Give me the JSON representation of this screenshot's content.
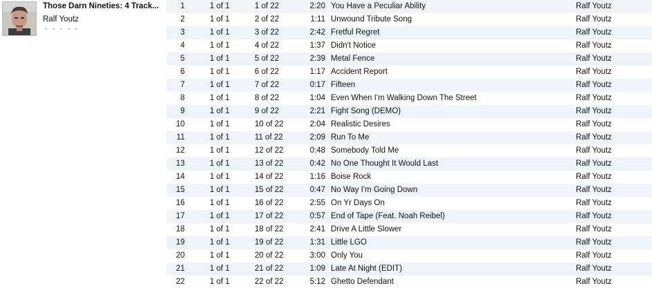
{
  "album": {
    "title": "Those Darn Nineties: 4 Track...",
    "artist": "Ralf Youtz",
    "rating_dots": [
      "•",
      "•",
      "•",
      "•",
      "•"
    ]
  },
  "tracks": [
    {
      "num": "1",
      "disc": "1 of 1",
      "track": "1 of 22",
      "time": "2:20",
      "name": "You Have a Peculiar Ability",
      "artist": "Ralf Youtz"
    },
    {
      "num": "2",
      "disc": "1 of 1",
      "track": "2 of 22",
      "time": "1:11",
      "name": "Unwound Tribute Song",
      "artist": "Ralf Youtz"
    },
    {
      "num": "3",
      "disc": "1 of 1",
      "track": "3 of 22",
      "time": "2:42",
      "name": "Fretful Regret",
      "artist": "Ralf Youtz"
    },
    {
      "num": "4",
      "disc": "1 of 1",
      "track": "4 of 22",
      "time": "1:37",
      "name": "Didn't Notice",
      "artist": "Ralf Youtz"
    },
    {
      "num": "5",
      "disc": "1 of 1",
      "track": "5 of 22",
      "time": "2:39",
      "name": "Metal Fence",
      "artist": "Ralf Youtz"
    },
    {
      "num": "6",
      "disc": "1 of 1",
      "track": "6 of 22",
      "time": "1:17",
      "name": "Accident Report",
      "artist": "Ralf Youtz"
    },
    {
      "num": "7",
      "disc": "1 of 1",
      "track": "7 of 22",
      "time": "0:17",
      "name": "Fifteen",
      "artist": "Ralf Youtz"
    },
    {
      "num": "8",
      "disc": "1 of 1",
      "track": "8 of 22",
      "time": "1:04",
      "name": "Even When I'm Walking Down The Street",
      "artist": "Ralf Youtz"
    },
    {
      "num": "9",
      "disc": "1 of 1",
      "track": "9 of 22",
      "time": "2:21",
      "name": "Fight Song (DEMO)",
      "artist": "Ralf Youtz"
    },
    {
      "num": "10",
      "disc": "1 of 1",
      "track": "10 of 22",
      "time": "2:04",
      "name": "Realistic Desires",
      "artist": "Ralf Youtz"
    },
    {
      "num": "11",
      "disc": "1 of 1",
      "track": "11 of 22",
      "time": "2:09",
      "name": "Run To Me",
      "artist": "Ralf Youtz"
    },
    {
      "num": "12",
      "disc": "1 of 1",
      "track": "12 of 22",
      "time": "0:48",
      "name": "Somebody Told Me",
      "artist": "Ralf Youtz"
    },
    {
      "num": "13",
      "disc": "1 of 1",
      "track": "13 of 22",
      "time": "0:42",
      "name": "No One Thought It Would Last",
      "artist": "Ralf Youtz"
    },
    {
      "num": "14",
      "disc": "1 of 1",
      "track": "14 of 22",
      "time": "1:16",
      "name": "Boise Rock",
      "artist": "Ralf Youtz"
    },
    {
      "num": "15",
      "disc": "1 of 1",
      "track": "15 of 22",
      "time": "0:47",
      "name": "No Way I'm Going Down",
      "artist": "Ralf Youtz"
    },
    {
      "num": "16",
      "disc": "1 of 1",
      "track": "16 of 22",
      "time": "2:55",
      "name": "On Yr Days On",
      "artist": "Ralf Youtz"
    },
    {
      "num": "17",
      "disc": "1 of 1",
      "track": "17 of 22",
      "time": "0:57",
      "name": "End of Tape (Feat. Noah Reibel)",
      "artist": "Ralf Youtz"
    },
    {
      "num": "18",
      "disc": "1 of 1",
      "track": "18 of 22",
      "time": "2:41",
      "name": "Drive A Little Slower",
      "artist": "Ralf Youtz"
    },
    {
      "num": "19",
      "disc": "1 of 1",
      "track": "19 of 22",
      "time": "1:31",
      "name": "Little LGO",
      "artist": "Ralf Youtz"
    },
    {
      "num": "20",
      "disc": "1 of 1",
      "track": "20 of 22",
      "time": "3:00",
      "name": "Only You",
      "artist": "Ralf Youtz"
    },
    {
      "num": "21",
      "disc": "1 of 1",
      "track": "21 of 22",
      "time": "1:09",
      "name": "Late At Night (EDIT)",
      "artist": "Ralf Youtz"
    },
    {
      "num": "22",
      "disc": "1 of 1",
      "track": "22 of 22",
      "time": "5:12",
      "name": "Ghetto Defendant",
      "artist": "Ralf Youtz"
    }
  ],
  "colors": {
    "row_alt": "#f0f4fa",
    "row_base": "#ffffff",
    "text": "#111111"
  }
}
